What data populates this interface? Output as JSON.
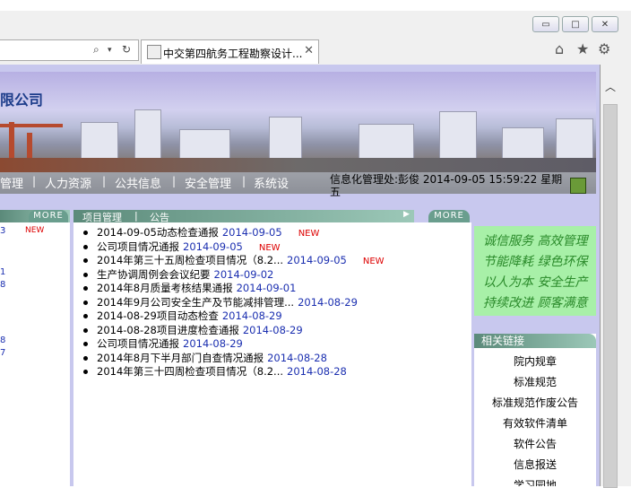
{
  "browser": {
    "tab_title": "中交第四航务工程勘察设计...",
    "address_icons": [
      "search-icon",
      "dropdown-icon",
      "refresh-icon"
    ],
    "window_buttons": [
      "minimize-icon",
      "maximize-icon",
      "close-icon"
    ],
    "toolbar_icons": [
      "home-icon",
      "star-icon",
      "gear-icon"
    ]
  },
  "banner": {
    "company_partial": "限公司"
  },
  "nav": {
    "items": [
      "管理",
      "人力资源",
      "公共信息",
      "安全管理",
      "系统设"
    ],
    "separator": "|",
    "info_text": "信息化管理处:彭俊 2014-09-05 15:59:22 星期五"
  },
  "left_panel": {
    "more": "MORE",
    "numbers": [
      "3",
      "1",
      "8",
      "8",
      "7"
    ],
    "new_badge": "NEW"
  },
  "main_panel": {
    "tabs": [
      "项目管理",
      "公告"
    ],
    "separator": "|",
    "more": "MORE",
    "items": [
      {
        "title": "2014-09-05动态检查通报",
        "date": "2014-09-05",
        "new": "NEW"
      },
      {
        "title": "公司项目情况通报",
        "date": "2014-09-05",
        "new": "NEW"
      },
      {
        "title": "2014年第三十五周检查项目情况（8.2...",
        "date": "2014-09-05",
        "new": "NEW"
      },
      {
        "title": "生产协调周例会会议纪要",
        "date": "2014-09-02",
        "new": ""
      },
      {
        "title": "2014年8月质量考核结果通报",
        "date": "2014-09-01",
        "new": ""
      },
      {
        "title": "2014年9月公司安全生产及节能减排管理...",
        "date": "2014-08-29",
        "new": ""
      },
      {
        "title": "2014-08-29项目动态检查",
        "date": "2014-08-29",
        "new": ""
      },
      {
        "title": "2014-08-28项目进度检查通报",
        "date": "2014-08-29",
        "new": ""
      },
      {
        "title": "公司项目情况通报",
        "date": "2014-08-29",
        "new": ""
      },
      {
        "title": "2014年8月下半月部门自查情况通报",
        "date": "2014-08-28",
        "new": ""
      },
      {
        "title": "2014年第三十四周检查项目情况（8.2...",
        "date": "2014-08-28",
        "new": ""
      }
    ]
  },
  "slogan": [
    "诚信服务 高效管理",
    "节能降耗 绿色环保",
    "以人为本 安全生产",
    "持续改进 顾客满意"
  ],
  "related_links": {
    "title": "相关链接",
    "items": [
      "院内规章",
      "标准规范",
      "标准规范作废公告",
      "有效软件清单",
      "软件公告",
      "信息报送",
      "学习园地"
    ]
  },
  "colors": {
    "link_blue": "#1b2fb0",
    "new_red": "#dd0000",
    "slogan_green": "#2a8a2a",
    "page_bg": "#c8c8ee"
  }
}
